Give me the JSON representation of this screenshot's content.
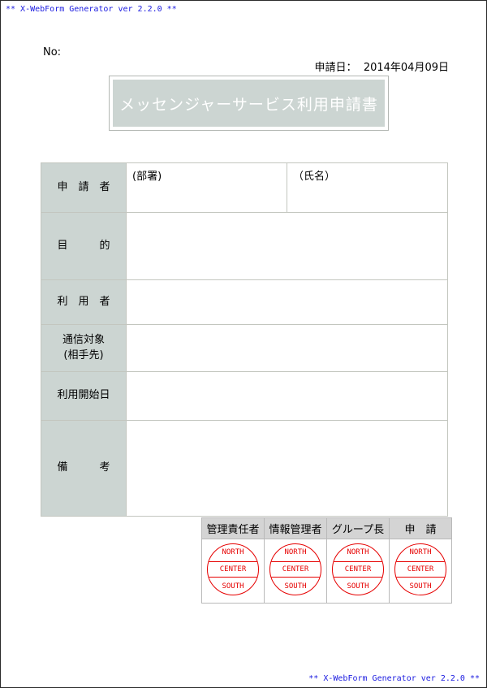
{
  "generator": {
    "header_banner": "** X-WebForm Generator ver 2.2.0 **",
    "footer_banner": "** X-WebForm Generator ver 2.2.0 **"
  },
  "meta": {
    "number_label": "No:",
    "date_label": "申請日：",
    "date_value": "2014年04月09日"
  },
  "title": {
    "text": "メッセンジャーサービス利用申請書",
    "fill_color": "#ccd5d2",
    "text_color": "#ffffff",
    "border_color": "#b3b7b3"
  },
  "form": {
    "label_fill": "#ccd5d2",
    "border_color": "#c3c6bf",
    "rows": [
      {
        "label": "申　請　者",
        "fields": [
          {
            "value": "(部署)"
          },
          {
            "value": "（氏名）"
          }
        ]
      },
      {
        "label": "目　　　的",
        "fields": [
          {
            "value": ""
          }
        ]
      },
      {
        "label": "利　用　者",
        "fields": [
          {
            "value": ""
          }
        ]
      },
      {
        "label": "通信対象\n(相手先)",
        "fields": [
          {
            "value": ""
          }
        ]
      },
      {
        "label": "利用開始日",
        "fields": [
          {
            "value": ""
          }
        ]
      },
      {
        "label": "備　　　考",
        "fields": [
          {
            "value": ""
          }
        ]
      }
    ]
  },
  "approval": {
    "header_fill": "#d4d4d4",
    "stamp_color": "#e60000",
    "columns": [
      {
        "header": "管理責任者"
      },
      {
        "header": "情報管理者"
      },
      {
        "header": "グループ長"
      },
      {
        "header": "申　請"
      }
    ],
    "stamp": {
      "top": "NORTH",
      "middle": "CENTER",
      "bottom": "SOUTH"
    }
  }
}
